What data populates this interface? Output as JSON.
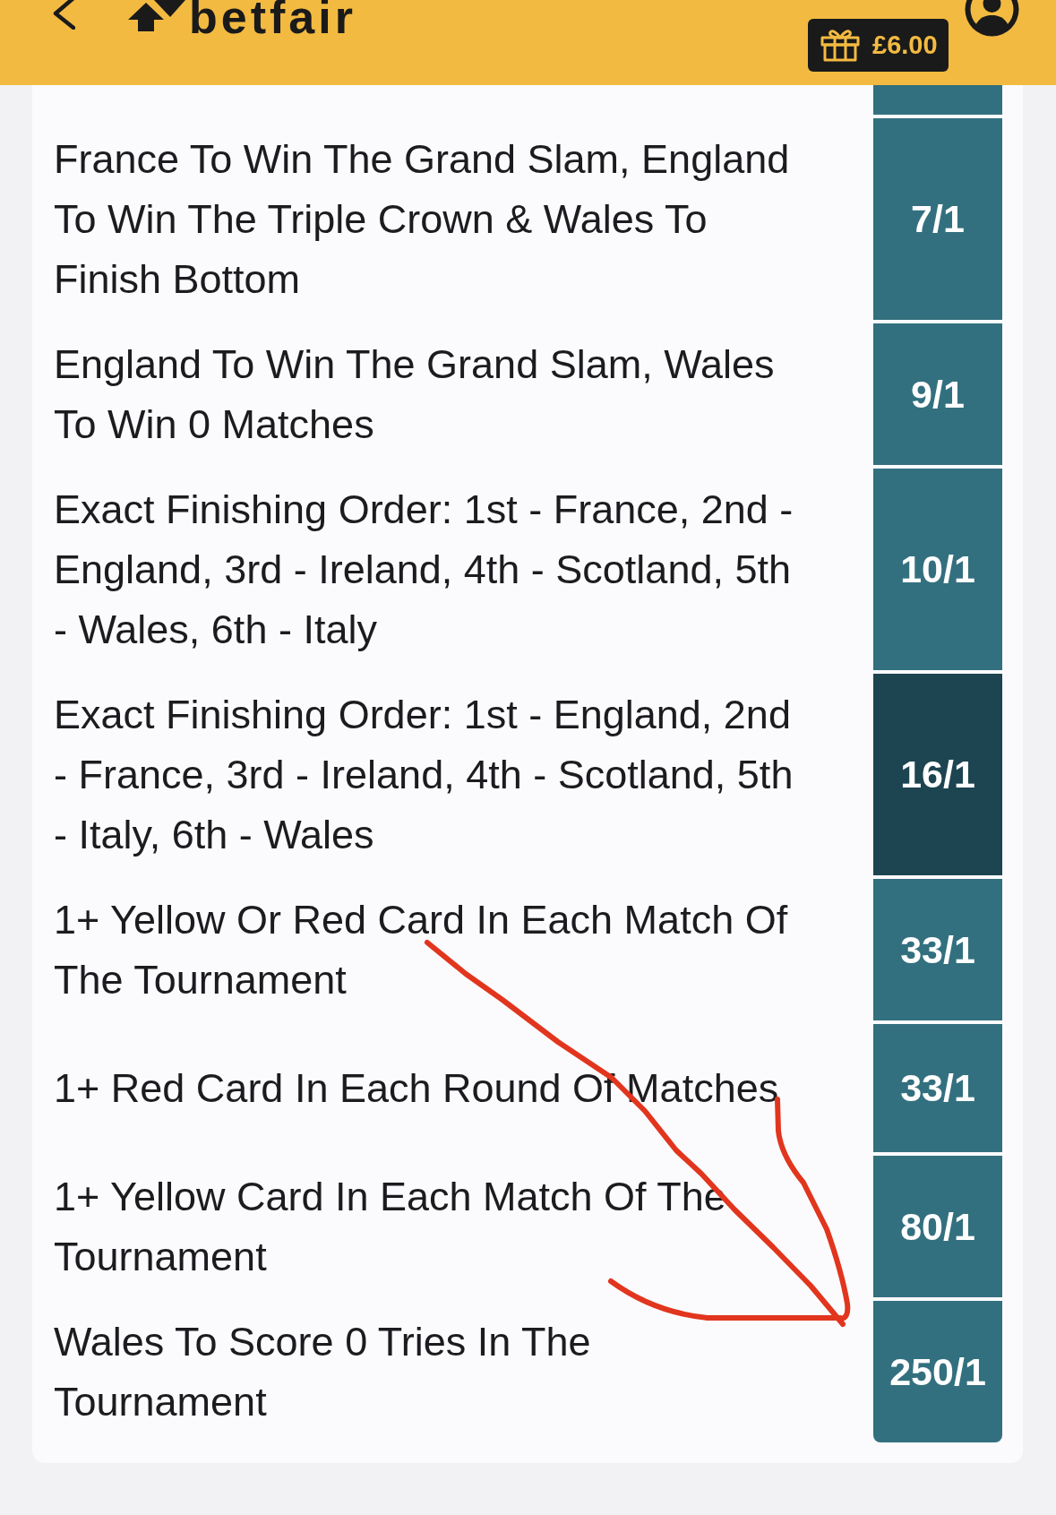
{
  "header": {
    "logo": "betfair",
    "balance": "£6.00"
  },
  "list": {
    "clipped_row_above": true
  },
  "markets": [
    {
      "name": "France To Win The Grand Slam, England To Win The Triple Crown & Wales To Finish Bottom",
      "odds": "7/1",
      "selected": false
    },
    {
      "name": "England To Win The Grand Slam, Wales To Win 0 Matches",
      "odds": "9/1",
      "selected": false
    },
    {
      "name": "Exact Finishing Order: 1st - France, 2nd - England, 3rd - Ireland, 4th - Scotland, 5th - Wales, 6th - Italy",
      "odds": "10/1",
      "selected": false
    },
    {
      "name": "Exact Finishing Order: 1st - England, 2nd - France, 3rd - Ireland, 4th - Scotland, 5th - Italy, 6th - Wales",
      "odds": "16/1",
      "selected": true
    },
    {
      "name": "1+ Yellow Or Red Card In Each Match Of The Tournament",
      "odds": "33/1",
      "selected": false
    },
    {
      "name": "1+ Red Card In Each Round Of Matches",
      "odds": "33/1",
      "selected": false
    },
    {
      "name": "1+ Yellow Card In Each Match Of The Tournament",
      "odds": "80/1",
      "selected": false
    },
    {
      "name": "Wales To Score 0 Tries In The Tournament",
      "odds": "250/1",
      "selected": false
    }
  ],
  "annotation": {
    "kind": "arrow"
  }
}
